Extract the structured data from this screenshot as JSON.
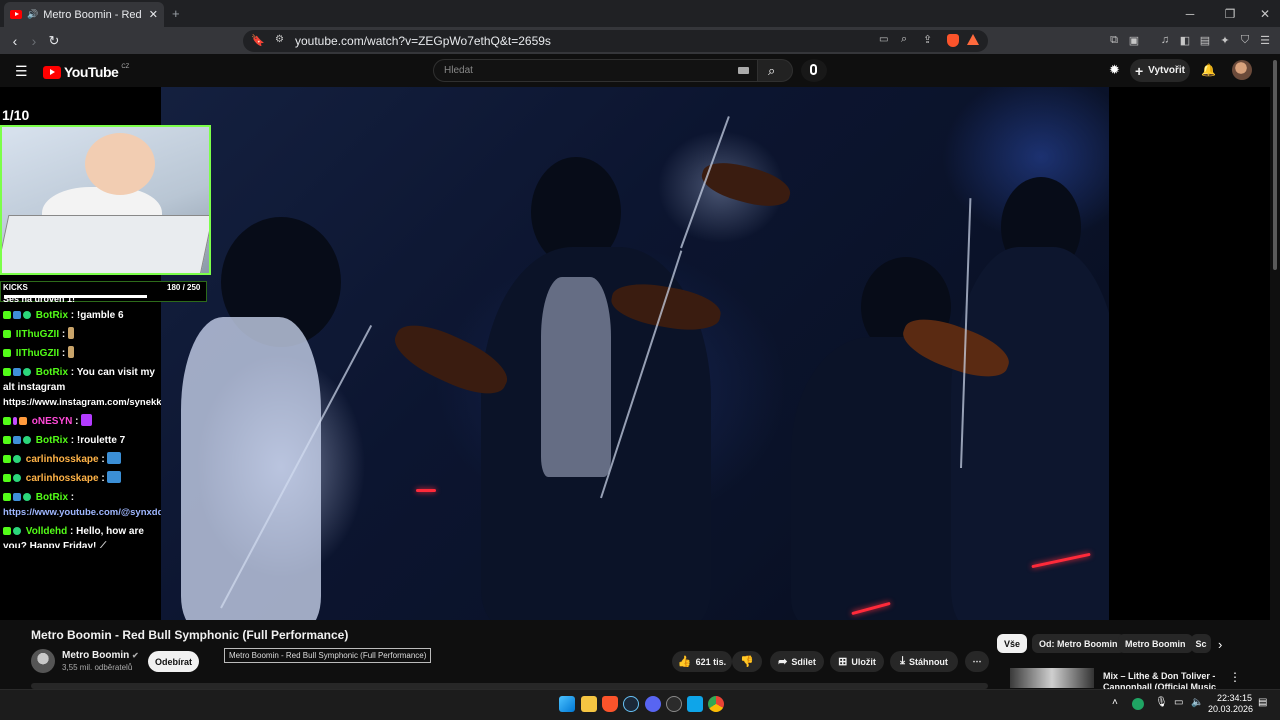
{
  "browser": {
    "tab_title": "Metro Boomin - Red Bull Sym",
    "url": "youtube.com/watch?v=ZEGpWo7ethQ&t=2659s"
  },
  "youtube": {
    "logo_text": "YouTube",
    "region": "CZ",
    "search_placeholder": "Hledat",
    "create_label": "Vytvořit"
  },
  "overlay": {
    "counter": "1/10",
    "kicks_label": "KICKS",
    "kicks_value": "180  / 250",
    "kicks_progress": 0.72,
    "chat_partial": "Ses na úroveň 1!",
    "chat": [
      {
        "user": "BotRix",
        "text": "!gamble 6"
      },
      {
        "user": "IIThuGZII",
        "text": ""
      },
      {
        "user": "IIThuGZII",
        "text": ""
      },
      {
        "user": "BotRix",
        "text": "You can visit my alt instagram",
        "link": "https://www.instagram.com/synekk_/"
      },
      {
        "user": "oNESYN",
        "text": ""
      },
      {
        "user": "BotRix",
        "text": "!roulette 7"
      },
      {
        "user": "carlinhosskape",
        "text": ""
      },
      {
        "user": "carlinhosskape",
        "text": ""
      },
      {
        "user": "BotRix",
        "text": "",
        "link": "https://www.youtube.com/@synxdd"
      },
      {
        "user": "Volldehd",
        "text": "Hello, how are you? Happy Friday!"
      }
    ]
  },
  "video": {
    "title": "Metro Boomin - Red Bull Symphonic (Full Performance)",
    "channel": "Metro Boomin",
    "subscribers": "3,55 mil. odběratelů",
    "subscribe_label": "Odebírat",
    "tooltip": "Metro Boomin - Red Bull Symphonic (Full Performance)",
    "likes": "621 tis.",
    "share_label": "Sdílet",
    "save_label": "Uložit",
    "download_label": "Stáhnout"
  },
  "chips": [
    "Vše",
    "Od: Metro Boomin",
    "Metro Boomin",
    "Sc"
  ],
  "recommendation": {
    "title": "Mix – Lithe & Don Toliver - Cannonball (Official Music"
  },
  "taskbar": {
    "time": "22:34:15",
    "date": "20.03.2026"
  },
  "colors": {
    "accent": "#ff0000",
    "chat_user": "#53fc18",
    "cam_border": "#7cff4a"
  }
}
